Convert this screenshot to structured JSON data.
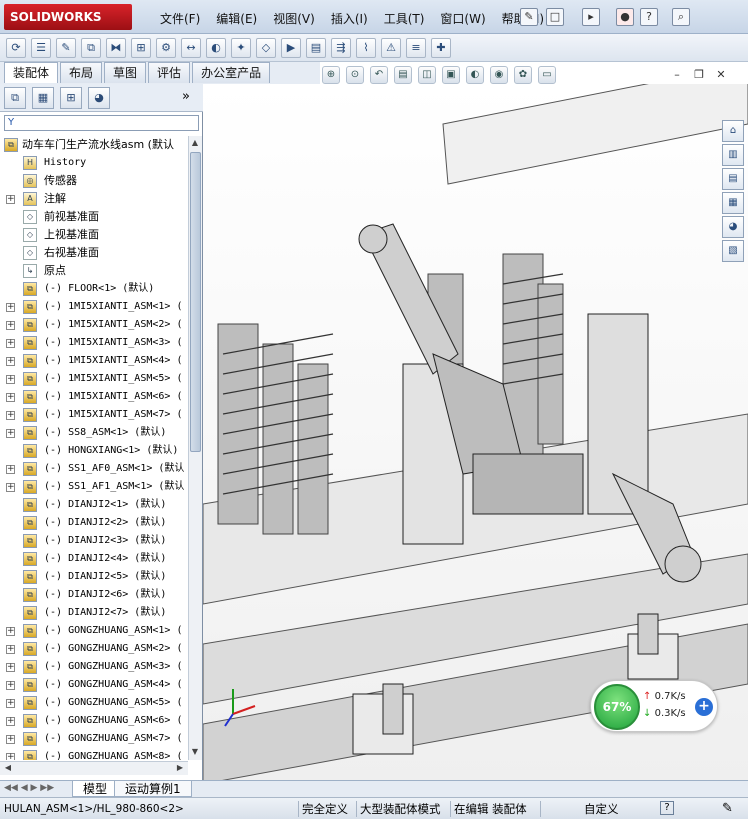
{
  "app": {
    "logo": "SOLIDWORKS",
    "menus": [
      "文件(F)",
      "编辑(E)",
      "视图(V)",
      "插入(I)",
      "工具(T)",
      "窗口(W)",
      "帮助(H)"
    ]
  },
  "command_tabs": [
    "装配体",
    "布局",
    "草图",
    "评估",
    "办公室产品"
  ],
  "filter_label": "Y",
  "tree": {
    "root": "动车车门生产流水线asm  (默认",
    "items": [
      {
        "label": "History",
        "type": "history",
        "exp": ""
      },
      {
        "label": "传感器",
        "type": "sensor",
        "exp": ""
      },
      {
        "label": "注解",
        "type": "annot",
        "exp": "+"
      },
      {
        "label": "前视基准面",
        "type": "plane",
        "exp": ""
      },
      {
        "label": "上视基准面",
        "type": "plane",
        "exp": ""
      },
      {
        "label": "右视基准面",
        "type": "plane",
        "exp": ""
      },
      {
        "label": "原点",
        "type": "origin",
        "exp": ""
      },
      {
        "label": "(-) FLOOR<1> (默认)",
        "type": "asm",
        "exp": ""
      },
      {
        "label": "(-) 1MI5XIANTI_ASM<1> (",
        "type": "asm",
        "exp": "+"
      },
      {
        "label": "(-) 1MI5XIANTI_ASM<2> (",
        "type": "asm",
        "exp": "+"
      },
      {
        "label": "(-) 1MI5XIANTI_ASM<3> (",
        "type": "asm",
        "exp": "+"
      },
      {
        "label": "(-) 1MI5XIANTI_ASM<4> (",
        "type": "asm",
        "exp": "+"
      },
      {
        "label": "(-) 1MI5XIANTI_ASM<5> (",
        "type": "asm",
        "exp": "+"
      },
      {
        "label": "(-) 1MI5XIANTI_ASM<6> (",
        "type": "asm",
        "exp": "+"
      },
      {
        "label": "(-) 1MI5XIANTI_ASM<7> (",
        "type": "asm",
        "exp": "+"
      },
      {
        "label": "(-) SS8_ASM<1> (默认)",
        "type": "asm",
        "exp": "+"
      },
      {
        "label": "(-) HONGXIANG<1> (默认)",
        "type": "asm",
        "exp": ""
      },
      {
        "label": "(-) SS1_AF0_ASM<1> (默认",
        "type": "asm",
        "exp": "+"
      },
      {
        "label": "(-) SS1_AF1_ASM<1> (默认",
        "type": "asm",
        "exp": "+"
      },
      {
        "label": "(-) DIANJI2<1> (默认)",
        "type": "asm",
        "exp": ""
      },
      {
        "label": "(-) DIANJI2<2> (默认)",
        "type": "asm",
        "exp": ""
      },
      {
        "label": "(-) DIANJI2<3> (默认)",
        "type": "asm",
        "exp": ""
      },
      {
        "label": "(-) DIANJI2<4> (默认)",
        "type": "asm",
        "exp": ""
      },
      {
        "label": "(-) DIANJI2<5> (默认)",
        "type": "asm",
        "exp": ""
      },
      {
        "label": "(-) DIANJI2<6> (默认)",
        "type": "asm",
        "exp": ""
      },
      {
        "label": "(-) DIANJI2<7> (默认)",
        "type": "asm",
        "exp": ""
      },
      {
        "label": "(-) GONGZHUANG_ASM<1> (",
        "type": "asm",
        "exp": "+"
      },
      {
        "label": "(-) GONGZHUANG_ASM<2> (",
        "type": "asm",
        "exp": "+"
      },
      {
        "label": "(-) GONGZHUANG_ASM<3> (",
        "type": "asm",
        "exp": "+"
      },
      {
        "label": "(-) GONGZHUANG_ASM<4> (",
        "type": "asm",
        "exp": "+"
      },
      {
        "label": "(-) GONGZHUANG_ASM<5> (",
        "type": "asm",
        "exp": "+"
      },
      {
        "label": "(-) GONGZHUANG_ASM<6> (",
        "type": "asm",
        "exp": "+"
      },
      {
        "label": "(-) GONGZHUANG_ASM<7> (",
        "type": "asm",
        "exp": "+"
      },
      {
        "label": "(-) GONGZHUANG_ASM<8> (",
        "type": "asm",
        "exp": "+"
      }
    ]
  },
  "bottom_tabs": [
    "模型",
    "运动算例1"
  ],
  "status": {
    "path": "HULAN_ASM<1>/HL_980-860<2>",
    "def": "完全定义",
    "mode": "大型装配体模式",
    "edit": "在编辑 装配体",
    "custom": "自定义"
  },
  "net": {
    "percent": "67%",
    "up": "0.7K/s",
    "down": "0.3K/s"
  },
  "colors": {
    "accent": "#d8232a",
    "selection": "#2a6fd6"
  }
}
